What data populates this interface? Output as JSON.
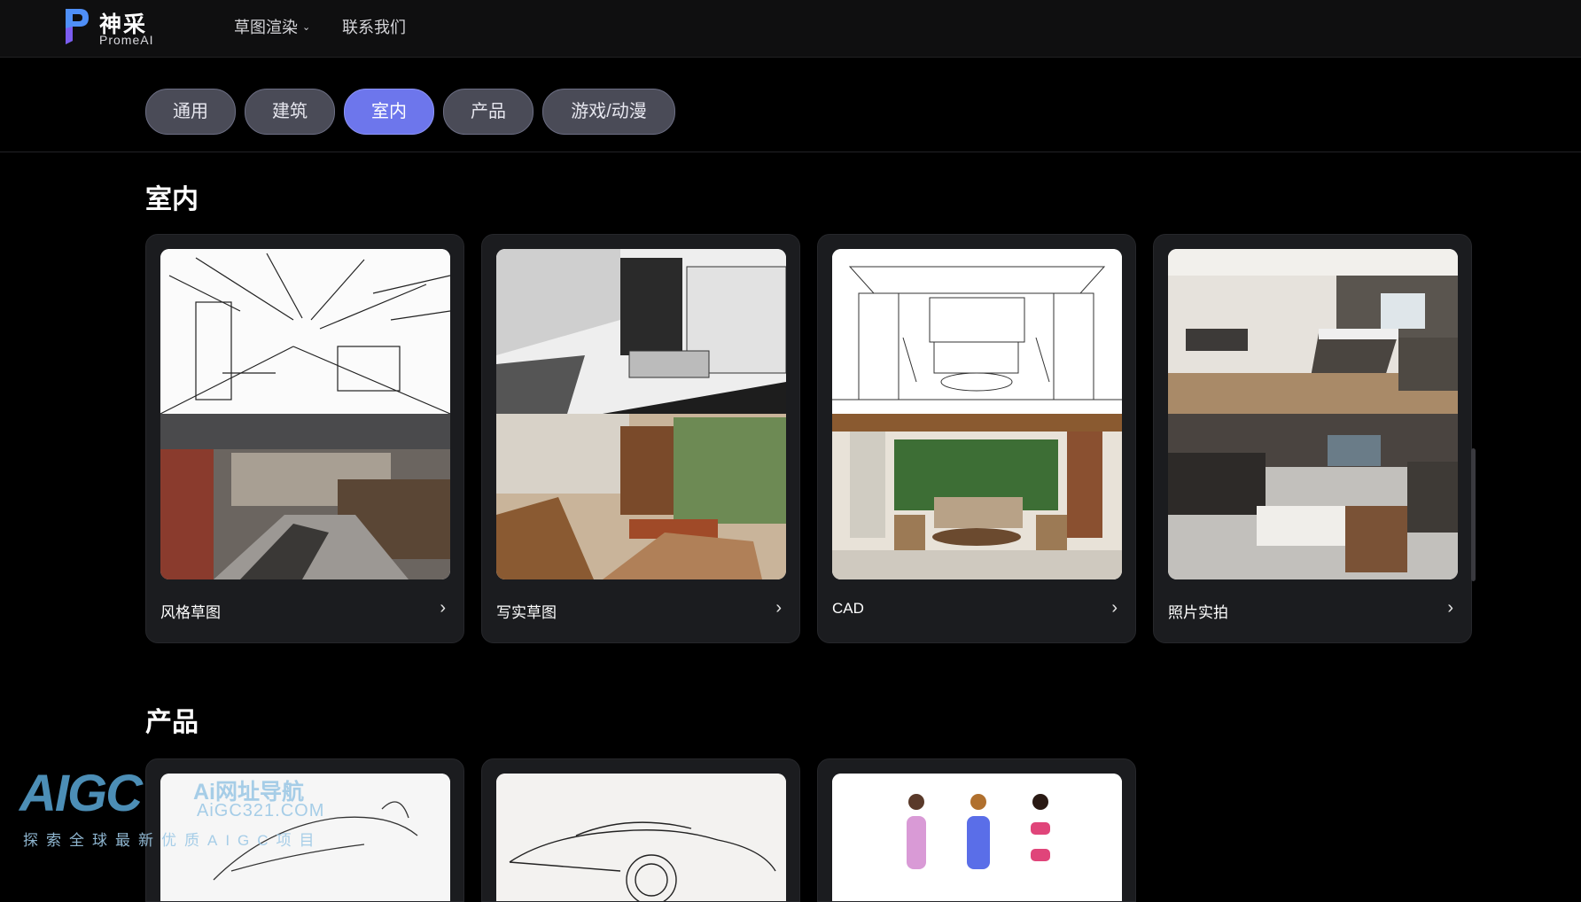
{
  "brand": {
    "name": "神采",
    "sub": "PromeAI"
  },
  "nav": [
    {
      "label": "草图渲染",
      "dropdown": true
    },
    {
      "label": "联系我们",
      "dropdown": false
    }
  ],
  "tabs": [
    {
      "label": "通用",
      "active": false
    },
    {
      "label": "建筑",
      "active": false
    },
    {
      "label": "室内",
      "active": true
    },
    {
      "label": "产品",
      "active": false
    },
    {
      "label": "游戏/动漫",
      "active": false
    }
  ],
  "sections": [
    {
      "title": "室内",
      "cards": [
        {
          "label": "风格草图",
          "arrow": "›"
        },
        {
          "label": "写实草图",
          "arrow": "›"
        },
        {
          "label": "CAD",
          "arrow": "›"
        },
        {
          "label": "照片实拍",
          "arrow": "›"
        }
      ]
    },
    {
      "title": "产品",
      "cards": [
        {
          "label": ""
        },
        {
          "label": ""
        },
        {
          "label": ""
        }
      ]
    }
  ],
  "watermark": {
    "logo": "AIGC",
    "cn": "Ai网址导航",
    "url": "AiGC321.COM",
    "slogan": "探索全球最新优质AIGC项目"
  },
  "colors": {
    "accent": "#6d76ec",
    "tab_bg": "#4a4b57",
    "card_bg": "#1b1c1f",
    "page_bg": "#000000"
  }
}
